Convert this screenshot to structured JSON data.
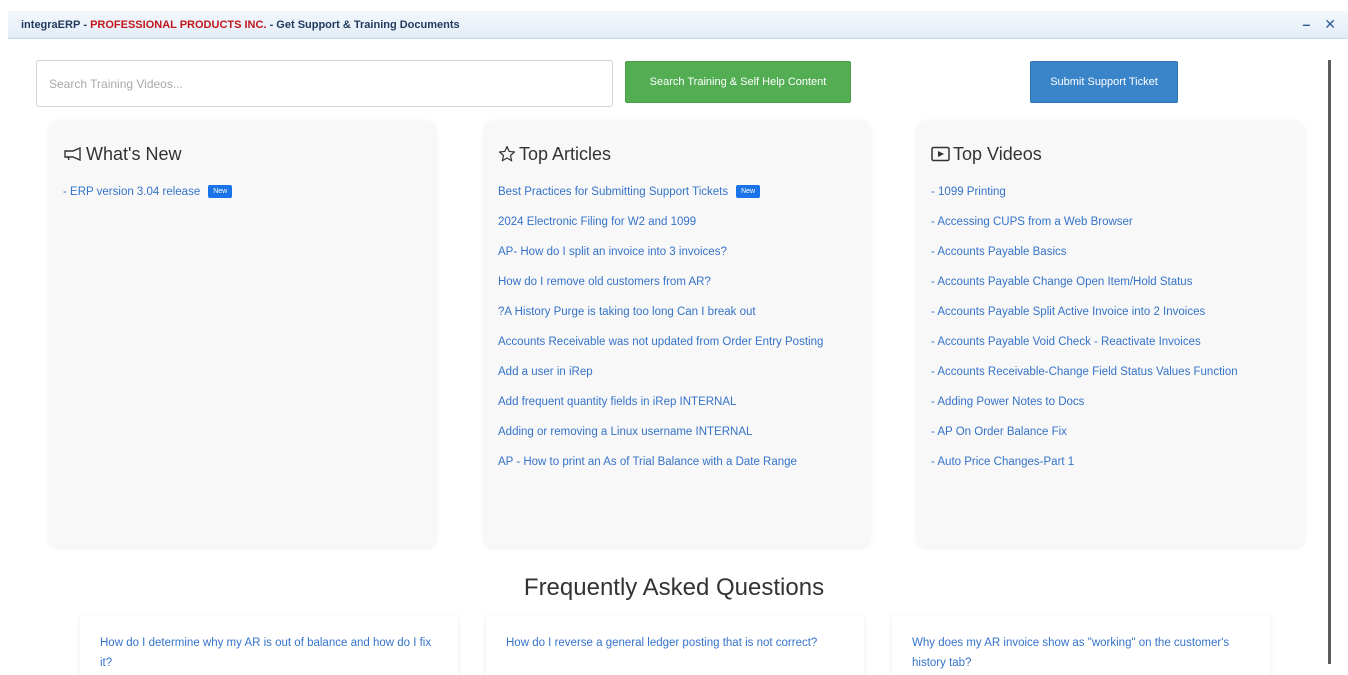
{
  "window": {
    "app": "integraERP",
    "sep1": " - ",
    "company": "PROFESSIONAL PRODUCTS INC.",
    "sep2": " - ",
    "page": "Get Support & Training Documents",
    "minimize": "–",
    "close": "✕"
  },
  "search": {
    "placeholder": "Search Training Videos...",
    "value": "",
    "button_label": "Search Training & Self Help Content"
  },
  "support": {
    "button_label": "Submit Support Ticket"
  },
  "whats_new": {
    "title": "What's New",
    "icon": "megaphone-icon",
    "items": [
      {
        "label": "- ERP version 3.04 release",
        "badge": "New"
      }
    ]
  },
  "top_articles": {
    "title": "Top Articles",
    "icon": "star-icon",
    "items": [
      {
        "label": "Best Practices for Submitting Support Tickets",
        "badge": "New"
      },
      {
        "label": "2024 Electronic Filing for W2 and 1099"
      },
      {
        "label": "AP- How do I split an invoice into 3 invoices?"
      },
      {
        "label": "How do I remove old customers from AR?"
      },
      {
        "label": "?A History Purge is taking too long Can I break out"
      },
      {
        "label": "Accounts Receivable was not updated from Order Entry Posting"
      },
      {
        "label": "Add a user in iRep"
      },
      {
        "label": "Add frequent quantity fields in iRep INTERNAL"
      },
      {
        "label": "Adding or removing a Linux username INTERNAL"
      },
      {
        "label": "AP - How to print an As of Trial Balance with a Date Range"
      }
    ]
  },
  "top_videos": {
    "title": "Top Videos",
    "icon": "video-icon",
    "items": [
      {
        "label": "- 1099 Printing"
      },
      {
        "label": "- Accessing CUPS from a Web Browser"
      },
      {
        "label": "- Accounts Payable Basics"
      },
      {
        "label": "- Accounts Payable Change Open Item/Hold Status"
      },
      {
        "label": "- Accounts Payable Split Active Invoice into 2 Invoices"
      },
      {
        "label": "- Accounts Payable Void Check - Reactivate Invoices"
      },
      {
        "label": "- Accounts Receivable-Change Field Status Values Function"
      },
      {
        "label": "- Adding Power Notes to Docs"
      },
      {
        "label": "- AP On Order Balance Fix"
      },
      {
        "label": "- Auto Price Changes-Part 1"
      }
    ]
  },
  "faq": {
    "title": "Frequently Asked Questions",
    "items": [
      {
        "label": "How do I determine why my AR is out of balance and how do I fix it?"
      },
      {
        "label": "How do I reverse a general ledger posting that is not correct?"
      },
      {
        "label": "Why does my AR invoice show as \"working\" on the customer's history tab?"
      }
    ]
  }
}
